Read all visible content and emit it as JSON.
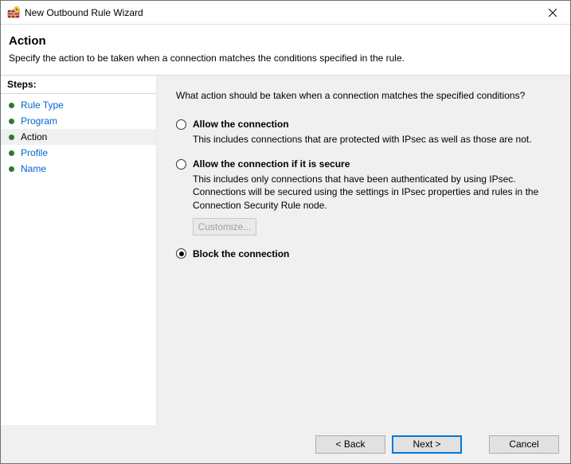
{
  "titlebar": {
    "title": "New Outbound Rule Wizard"
  },
  "header": {
    "heading": "Action",
    "subtitle": "Specify the action to be taken when a connection matches the conditions specified in the rule."
  },
  "sidebar": {
    "title": "Steps:",
    "items": [
      {
        "label": "Rule Type",
        "state": "done"
      },
      {
        "label": "Program",
        "state": "done"
      },
      {
        "label": "Action",
        "state": "current"
      },
      {
        "label": "Profile",
        "state": "todo"
      },
      {
        "label": "Name",
        "state": "todo"
      }
    ]
  },
  "content": {
    "prompt": "What action should be taken when a connection matches the specified conditions?",
    "options": [
      {
        "id": "allow",
        "title": "Allow the connection",
        "desc": "This includes connections that are protected with IPsec as well as those are not.",
        "checked": false
      },
      {
        "id": "allow-secure",
        "title": "Allow the connection if it is secure",
        "desc": "This includes only connections that have been authenticated by using IPsec.  Connections will be secured using the settings in IPsec properties and rules in the Connection Security Rule node.",
        "checked": false,
        "customize_label": "Customize..."
      },
      {
        "id": "block",
        "title": "Block the connection",
        "desc": "",
        "checked": true
      }
    ]
  },
  "footer": {
    "back": "< Back",
    "next": "Next >",
    "cancel": "Cancel"
  }
}
